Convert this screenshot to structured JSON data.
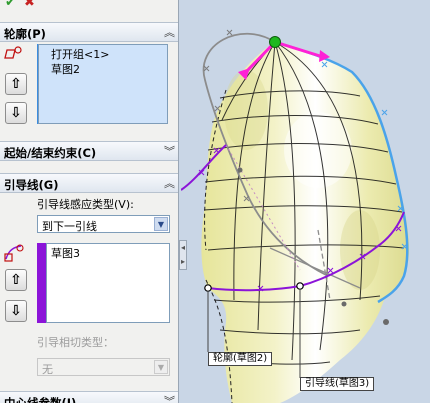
{
  "toolbar": {
    "ok_icon": "checkmark-icon",
    "cancel_icon": "close-icon"
  },
  "profile_section": {
    "title": "轮廓(P)",
    "items": [
      "打开组<1>",
      "草图2"
    ],
    "list_color": "#3b8de0"
  },
  "constraint_section": {
    "title": "起始/结束约束(C)"
  },
  "guide_section": {
    "title": "引导线(G)",
    "influence_label": "引导线感应类型(V):",
    "influence_value": "到下一引线",
    "items": [
      "草图3"
    ],
    "list_color": "#8b14d8",
    "tangency_label": "引导相切类型：",
    "tangency_value": "无"
  },
  "centerline_section": {
    "title": "中心线参数(I)"
  },
  "view": {
    "callout_profile": "轮廓(草图2)",
    "callout_guide": "引导线(草图3)",
    "colors": {
      "surface": "#ecebb0",
      "profile": "#4aa3ea",
      "guide": "#8b14d8",
      "handle": "#ff21d6",
      "point": "#1fb81f"
    }
  }
}
